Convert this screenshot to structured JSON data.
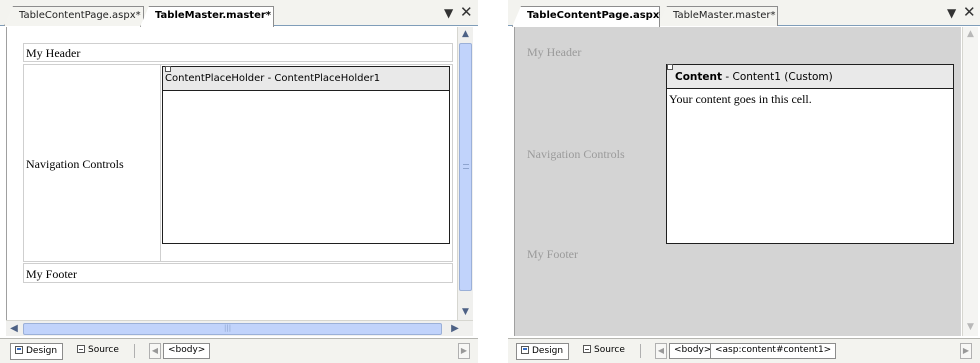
{
  "colors": {
    "tab_border": "#8d8d8d",
    "content_page_background": "#d4d4d4",
    "scroll_thumb": "#c1d3fb",
    "scroll_arrow": "#4d6185"
  },
  "left": {
    "tabs": [
      {
        "label": "TableContentPage.aspx*",
        "active": false
      },
      {
        "label": "TableMaster.master*",
        "active": true
      }
    ],
    "pin_glyph": "▼",
    "close_glyph": "✕",
    "header_text": "My Header",
    "navigation_text": "Navigation Controls",
    "footer_text": "My Footer",
    "placeholder_title": "ContentPlaceHolder - ContentPlaceHolder1",
    "scroll_arrows": {
      "up": "▲",
      "down": "▼",
      "left": "◀",
      "right": "▶"
    },
    "hscroll_grip": "|||",
    "bottom": {
      "design_label": "Design",
      "source_label": "Source",
      "prev_arrow": "◀",
      "next_arrow": "▶",
      "tags": [
        "<body>"
      ]
    }
  },
  "right": {
    "tabs": [
      {
        "label": "TableContentPage.aspx*",
        "active": true
      },
      {
        "label": "TableMaster.master*",
        "active": false
      }
    ],
    "pin_glyph": "▼",
    "close_glyph": "✕",
    "header_text": "My Header",
    "navigation_text": "Navigation Controls",
    "footer_text": "My Footer",
    "content_title_bold": "Content",
    "content_title_rest": " - Content1 (Custom)",
    "content_body": "Your content goes in this cell.",
    "scroll_arrows": {
      "up": "▲",
      "down": "▼"
    },
    "bottom": {
      "design_label": "Design",
      "source_label": "Source",
      "prev_arrow": "◀",
      "next_arrow": "▶",
      "tags": [
        "<body>",
        "<asp:content#content1>"
      ]
    }
  }
}
